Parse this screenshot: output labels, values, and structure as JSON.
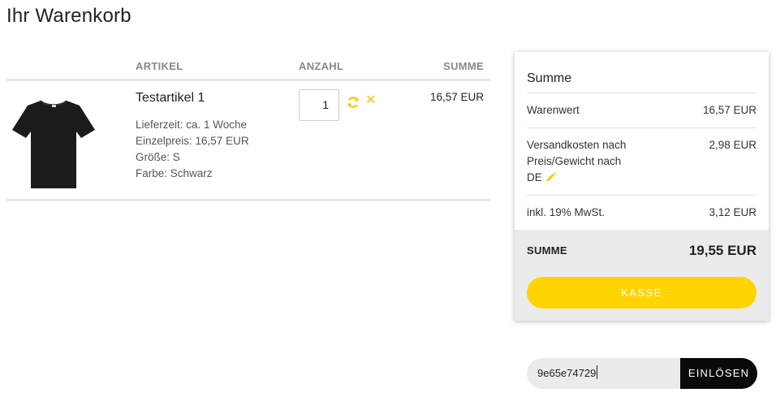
{
  "page": {
    "title": "Ihr Warenkorb"
  },
  "cart": {
    "headers": {
      "artikel": "ARTIKEL",
      "anzahl": "ANZAHL",
      "summe": "SUMME"
    },
    "items": [
      {
        "name": "Testartikel 1",
        "image_icon": "black-tshirt",
        "meta": [
          "Lieferzeit: ca. 1 Woche",
          "Einzelpreis: 16,57 EUR",
          "Größe: S",
          "Farbe: Schwarz"
        ],
        "quantity": "1",
        "sum": "16,57 EUR"
      }
    ]
  },
  "summary": {
    "title": "Summe",
    "warenwert_label": "Warenwert",
    "warenwert_value": "16,57 EUR",
    "versand_label_lines": [
      "Versandkosten nach",
      "Preis/Gewicht nach",
      "DE"
    ],
    "versand_value": "2,98 EUR",
    "mwst_label": "inkl. 19% MwSt.",
    "mwst_value": "3,12 EUR",
    "total_label": "SUMME",
    "total_value": "19,55 EUR",
    "checkout_label": "KASSE"
  },
  "coupon": {
    "value": "9e65e74729",
    "button_label": "EINLÖSEN"
  },
  "colors": {
    "accent": "#ffd400",
    "button_dark": "#0a0a0a",
    "band": "#ebebeb"
  }
}
